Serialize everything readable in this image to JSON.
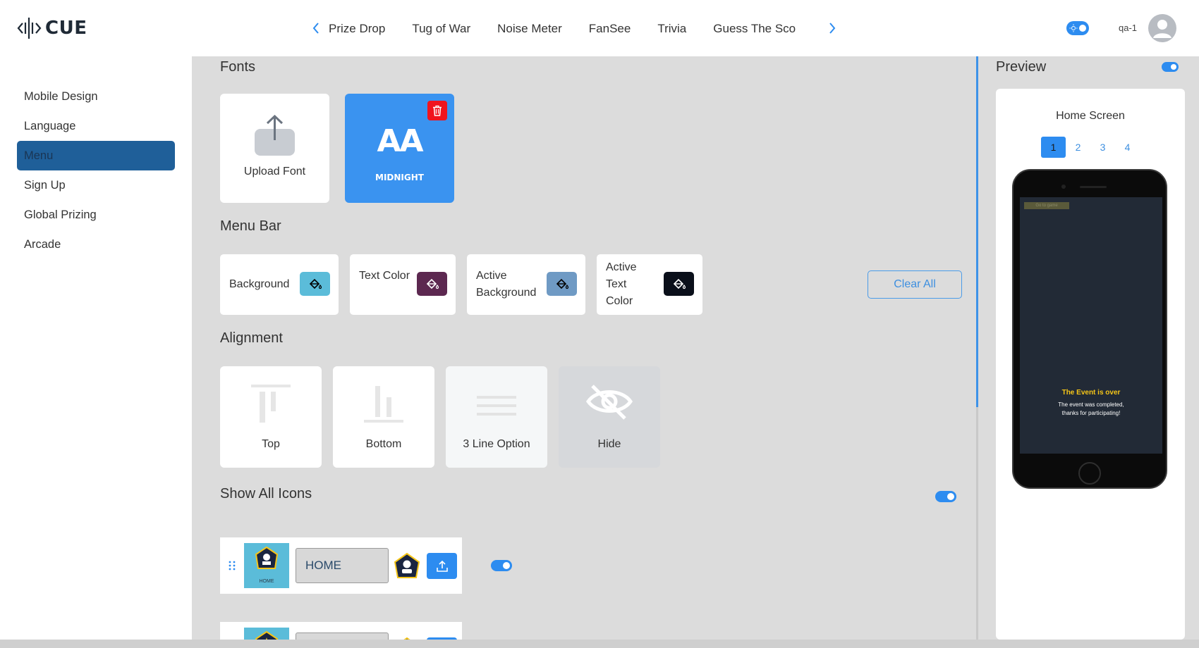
{
  "app": {
    "logo_text": "CUE"
  },
  "header": {
    "tabs": [
      "Prize Drop",
      "Tug of War",
      "Noise Meter",
      "FanSee",
      "Trivia",
      "Guess The Sco"
    ],
    "user_name": "qa-1"
  },
  "sidebar": {
    "items": [
      {
        "label": "Mobile Design",
        "active": false
      },
      {
        "label": "Language",
        "active": false
      },
      {
        "label": "Menu",
        "active": true
      },
      {
        "label": "Sign Up",
        "active": false
      },
      {
        "label": "Global Prizing",
        "active": false
      },
      {
        "label": "Arcade",
        "active": false
      }
    ]
  },
  "fonts": {
    "title": "Fonts",
    "upload_label": "Upload Font",
    "font_preview": "AA",
    "font_name": "MIDNIGHT"
  },
  "menu_bar": {
    "title": "Menu Bar",
    "colors": [
      {
        "label": "Background",
        "swatch": "#5bbcd9"
      },
      {
        "label": "Text Color",
        "swatch": "#5c2850"
      },
      {
        "label": "Active Background",
        "swatch": "#6f9ac4"
      },
      {
        "label": "Active Text Color",
        "swatch": "#0a0f1a"
      }
    ],
    "clear_all": "Clear All"
  },
  "alignment": {
    "title": "Alignment",
    "options": [
      "Top",
      "Bottom",
      "3 Line Option",
      "Hide"
    ]
  },
  "icons": {
    "title": "Show All Icons",
    "show_all_enabled": true,
    "rows": [
      {
        "thumb_label": "HOME",
        "name": "HOME",
        "enabled": true
      },
      {
        "thumb_label": "",
        "name": "",
        "enabled": true
      }
    ]
  },
  "preview": {
    "title": "Preview",
    "enabled": true,
    "screen_name": "Home Screen",
    "pages": [
      "1",
      "2",
      "3",
      "4"
    ],
    "active_page": "1",
    "phone": {
      "goto_label": "Go to game",
      "event_title": "The Event is over",
      "event_line1": "The event was completed,",
      "event_line2": "thanks for participating!"
    }
  },
  "colors": {
    "accent": "#2d8cf0",
    "active_nav": "#1f5f99",
    "danger": "#f0141e",
    "event_title": "#f5c518"
  }
}
